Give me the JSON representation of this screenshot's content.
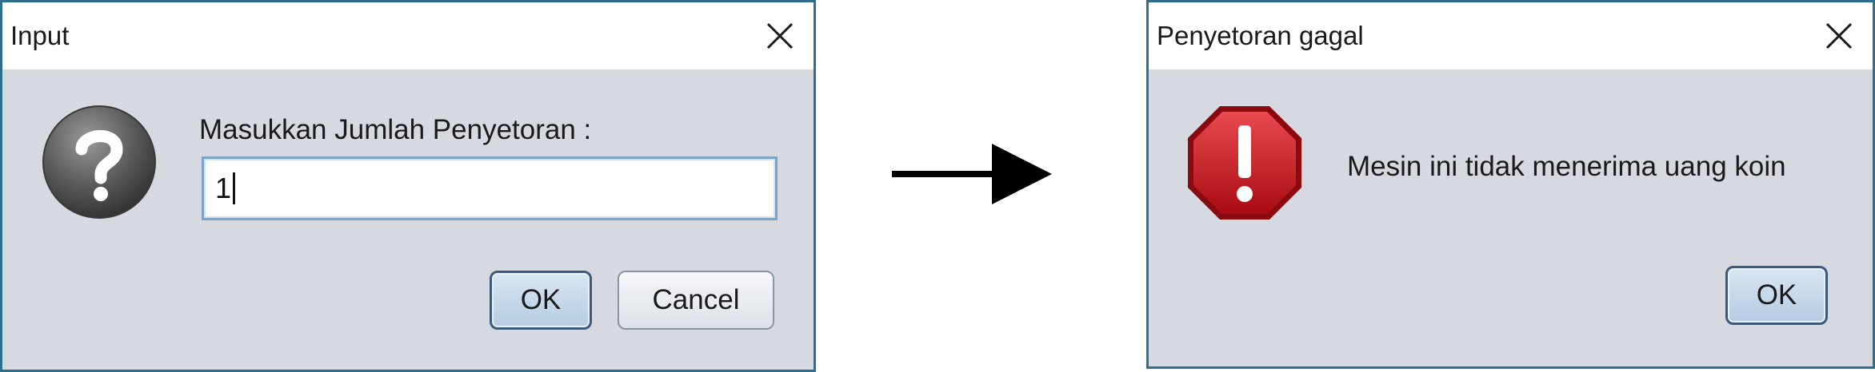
{
  "input_dialog": {
    "title": "Input",
    "icon": "question-icon",
    "message": "Masukkan Jumlah Penyetoran :",
    "field_value": "1",
    "ok_label": "OK",
    "cancel_label": "Cancel"
  },
  "error_dialog": {
    "title": "Penyetoran gagal",
    "icon": "error-stop-icon",
    "message": "Mesin ini tidak menerima uang koin",
    "ok_label": "OK"
  },
  "colors": {
    "dialog_bg": "#d6d9df",
    "titlebar_bg": "#ffffff",
    "border": "#2e6f8e",
    "error_red": "#c8161d",
    "arrow": "#000000"
  }
}
